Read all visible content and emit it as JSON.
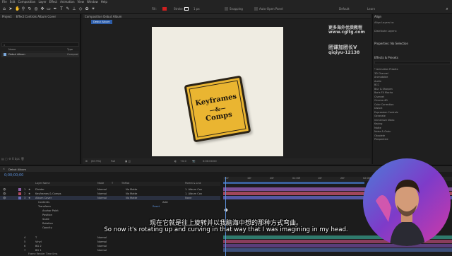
{
  "menubar": [
    "File",
    "Edit",
    "Composition",
    "Layer",
    "Effect",
    "Animation",
    "View",
    "Window",
    "Help"
  ],
  "toolbar": {
    "snapping": "Snapping",
    "auto_open_panel": "Auto-Open Panel",
    "workspace": "Default",
    "learn": "Learn",
    "fill_color": "#d02020",
    "stroke_color": "#ffffff",
    "stroke_px": "1 px"
  },
  "project": {
    "tab": "Project",
    "effect_controls": "Effect Controls Album Cover",
    "search_placeholder": "⌕",
    "col_name": "Name",
    "col_type": "Type",
    "item_name": "Debut Album",
    "item_type": "Composi"
  },
  "comp": {
    "tab": "Composition Debut Album",
    "breadcrumb": "Debut Album",
    "sticker_line1": "Keyframes",
    "sticker_line2": "—&—",
    "sticker_line3": "Comps",
    "zoom": "(67.9%)",
    "resolution": "Full",
    "offset": "+0.0",
    "timecode": "0:00:00:00"
  },
  "right_panel": {
    "align": "Align",
    "align_layers_to": "Align Layers to:",
    "distribute": "Distribute Layers:",
    "properties": "Properties: No Selection",
    "effects": "Effects & Presets",
    "effects_list": [
      "* Animation Presets",
      "3D Channel",
      "Animatable",
      "Audio",
      "BCC",
      "Blur & Sharpen",
      "Boris FX Mocha",
      "Channel",
      "Cinema 4D",
      "Color Correction",
      "Distort",
      "Expression Controls",
      "Generate",
      "Immersive Video",
      "Keying",
      "Matte",
      "Noise & Grain",
      "Obsolete",
      "Perspective"
    ]
  },
  "watermark": {
    "line1": "更多海外优质教程",
    "line2": "www.cgltg.com",
    "line3": "团课加团长V",
    "line4": "qiqiyu-12138"
  },
  "timeline": {
    "tab": "Debut Album",
    "timecode": "0;00;00;00",
    "columns": [
      "Layer Name",
      "Mode",
      "T",
      "TrkMat",
      "Parent & Link"
    ],
    "layers": [
      {
        "num": "1",
        "name": "Divider",
        "mode": "Normal",
        "trkmat": "No Matte",
        "parent": "1. Album Cov"
      },
      {
        "num": "2",
        "name": "Keyframes & Comps",
        "mode": "Normal",
        "trkmat": "No Matte",
        "parent": "1. Album Cov"
      },
      {
        "num": "3",
        "name": "Album Cover",
        "mode": "Normal",
        "trkmat": "No Matte",
        "parent": "None"
      }
    ],
    "props": [
      "Contents",
      "Transform",
      "Anchor Point",
      "Position",
      "Scale",
      "Rotation",
      "Opacity"
    ],
    "reset": "Reset",
    "add": "Add:",
    "lower_layers": [
      {
        "num": "4",
        "name": "T",
        "mode": "Normal"
      },
      {
        "num": "5",
        "name": "Vinyl",
        "mode": "Normal"
      },
      {
        "num": "6",
        "name": "BG 2",
        "mode": "Normal"
      },
      {
        "num": "7",
        "name": "BG 1",
        "mode": "Normal"
      }
    ],
    "frame_render": "Frame Render Time 0ms",
    "ticks": [
      "00f",
      "10f",
      "20f",
      "01:00f",
      "10f",
      "20f",
      "02:00f",
      "10f"
    ]
  },
  "subtitles": {
    "zh": "现在它就是往上旋转并以我脑海中想的那种方式弯曲。",
    "en": "So now it's rotating up and curving in that way that I was imagining in my head."
  }
}
